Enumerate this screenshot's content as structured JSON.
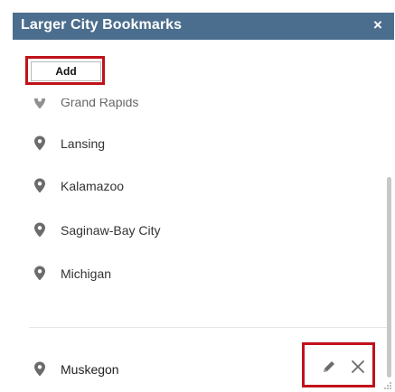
{
  "panel": {
    "title": "Larger City Bookmarks",
    "close_glyph": "×",
    "add_label": "Add"
  },
  "bookmarks": [
    {
      "label": "Grand Rapids",
      "icon": "map-pin-icon"
    },
    {
      "label": "Lansing",
      "icon": "map-pin-icon"
    },
    {
      "label": "Kalamazoo",
      "icon": "map-pin-icon"
    },
    {
      "label": "Saginaw-Bay City",
      "icon": "map-pin-icon"
    },
    {
      "label": "Michigan",
      "icon": "map-pin-icon"
    },
    {
      "label": "Muskegon",
      "icon": "map-pin-icon"
    }
  ],
  "colors": {
    "header": "#4c6e8e",
    "highlight": "#c0121a",
    "pin": "#6b6b6b",
    "text": "#333333"
  }
}
